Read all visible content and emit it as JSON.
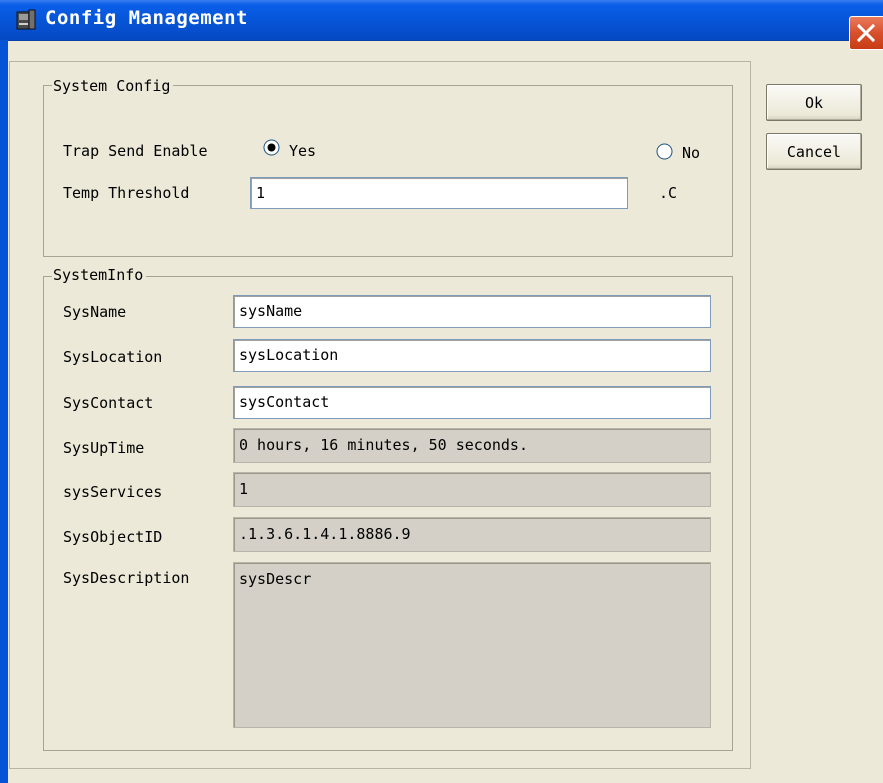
{
  "window": {
    "title": "Config Management",
    "icon": "app-icon",
    "close_icon": "close-icon"
  },
  "system_config": {
    "caption": "System Config",
    "trap_label": "Trap Send Enable",
    "trap_yes_label": "Yes",
    "trap_no_label": "No",
    "trap_selected": "Yes",
    "temp_label": "Temp Threshold",
    "temp_value": "1",
    "temp_unit": ".C"
  },
  "system_info": {
    "caption": "SystemInfo",
    "sysname_label": "SysName",
    "sysname_value": "sysName",
    "syslocation_label": "SysLocation",
    "syslocation_value": "sysLocation",
    "syscontact_label": "SysContact",
    "syscontact_value": "sysContact",
    "sysuptime_label": "SysUpTime",
    "sysuptime_value": "0 hours, 16 minutes, 50 seconds.",
    "sysservices_label": "sysServices",
    "sysservices_value": "1",
    "sysobjectid_label": "SysObjectID",
    "sysobjectid_value": ".1.3.6.1.4.1.8886.9",
    "sysdescription_label": "SysDescription",
    "sysdescription_value": "sysDescr"
  },
  "buttons": {
    "ok_label": "Ok",
    "cancel_label": "Cancel"
  },
  "colors": {
    "titlebar": "#0654d6",
    "dialog_bg": "#ece9d8",
    "readonly_bg": "#d4d0c8",
    "close_button": "#d8502c"
  }
}
